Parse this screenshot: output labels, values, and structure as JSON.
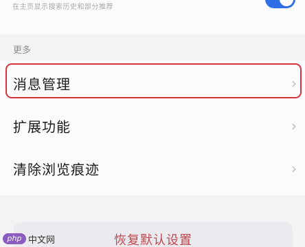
{
  "top_setting": {
    "description": "在主页显示搜索历史和部分推荐",
    "toggle_on": true
  },
  "section": {
    "title": "更多"
  },
  "items": [
    {
      "label": "消息管理",
      "chevron": "›",
      "highlighted": true
    },
    {
      "label": "扩展功能",
      "chevron": "›"
    },
    {
      "label": "清除浏览痕迹",
      "chevron": "›"
    }
  ],
  "reset": {
    "label": "恢复默认设置"
  },
  "watermark": {
    "badge": "php",
    "text": "中文网"
  },
  "colors": {
    "accent": "#2f6fe6",
    "highlight_border": "#d9323a",
    "reset_text": "#c0484e",
    "watermark_badge": "#8a5cc0"
  }
}
